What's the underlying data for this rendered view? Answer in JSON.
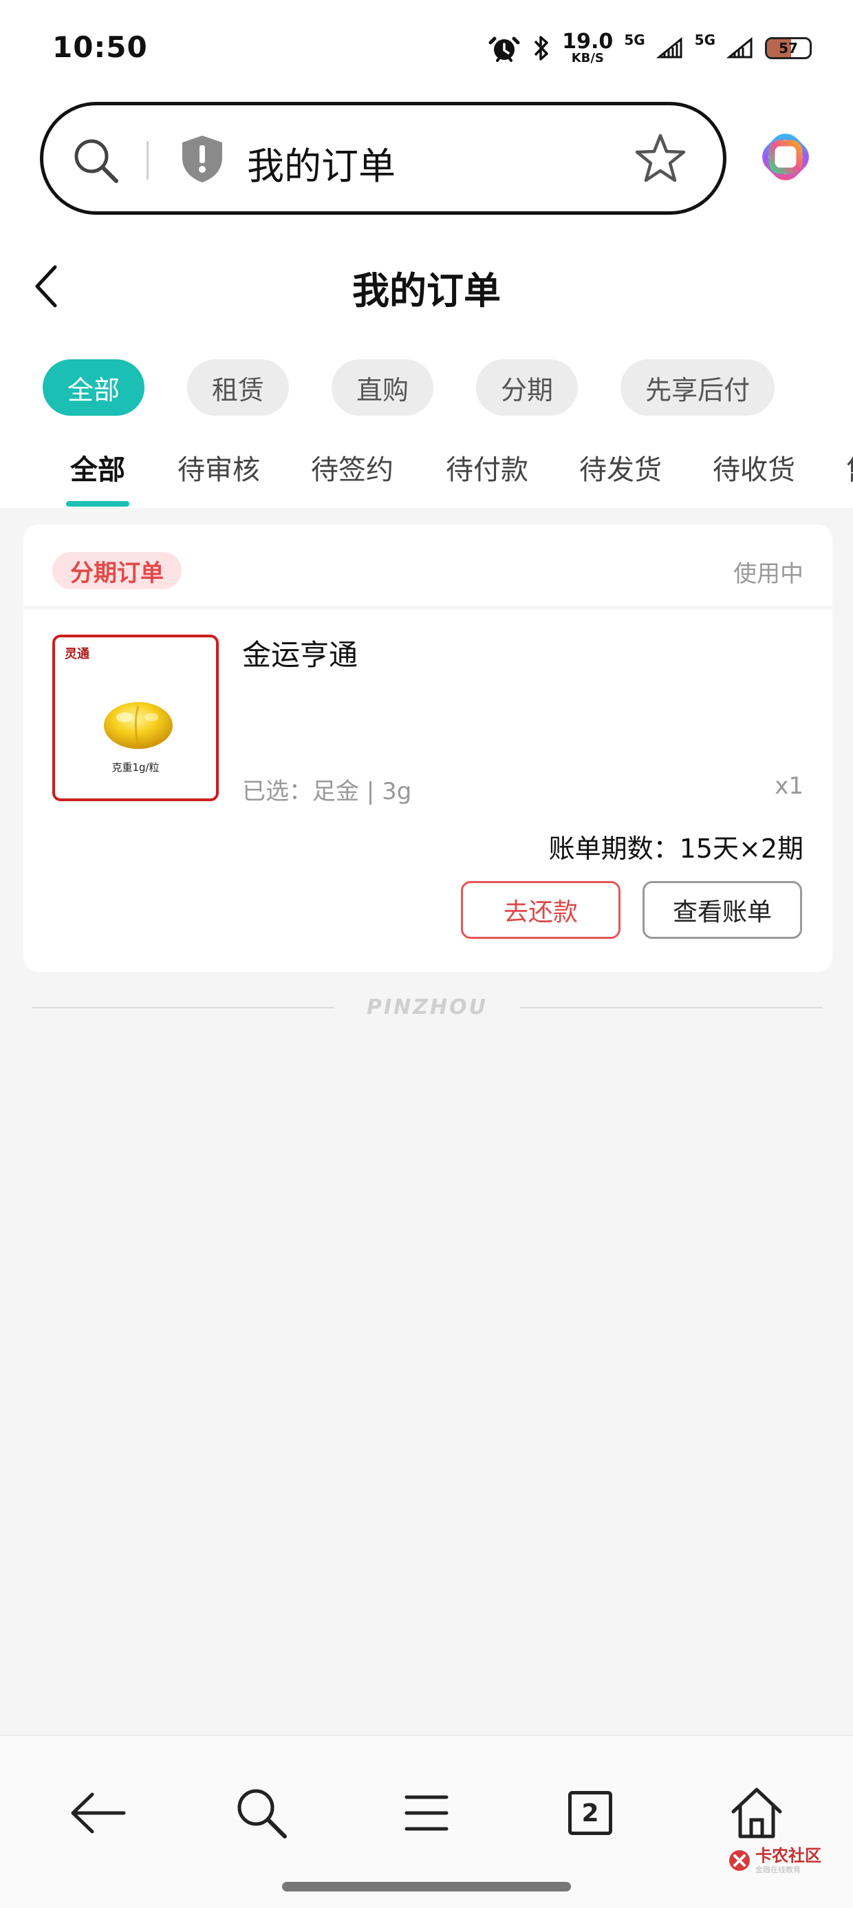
{
  "status_bar": {
    "time": "10:50",
    "speed_value": "19.0",
    "speed_unit": "KB/S",
    "network_1": "5G",
    "network_2": "5G",
    "battery": "57",
    "battery_level": 0.57,
    "icons": [
      "alarm-icon",
      "bluetooth-icon",
      "signal-icon",
      "signal-icon",
      "battery-icon"
    ]
  },
  "search_bar": {
    "text": "我的订单",
    "icons": [
      "search-icon",
      "shield-alert-icon",
      "star-icon",
      "app-logo-icon"
    ]
  },
  "header": {
    "title": "我的订单",
    "back_icon": "chevron-left-icon"
  },
  "categories": [
    {
      "label": "全部",
      "active": true
    },
    {
      "label": "租赁",
      "active": false
    },
    {
      "label": "直购",
      "active": false
    },
    {
      "label": "分期",
      "active": false
    },
    {
      "label": "先享后付",
      "active": false
    }
  ],
  "status_tabs": [
    {
      "label": "全部",
      "active": true
    },
    {
      "label": "待审核",
      "active": false
    },
    {
      "label": "待签约",
      "active": false
    },
    {
      "label": "待付款",
      "active": false
    },
    {
      "label": "待发货",
      "active": false
    },
    {
      "label": "待收货",
      "active": false
    },
    {
      "label": "售",
      "active": false
    }
  ],
  "order": {
    "badge": "分期订单",
    "status": "使用中",
    "thumbnail_brand": "灵通",
    "thumbnail_spec": "克重1g/粒",
    "product_name": "金运亨通",
    "selected": "已选：足金 | 3g",
    "quantity": "x1",
    "bill_period": "账单期数：15天×2期",
    "repay_button": "去还款",
    "view_bill_button": "查看账单"
  },
  "footer_mark": "PINZHOU",
  "bottom_nav": {
    "tab_count": "2",
    "icons": [
      "back-arrow-icon",
      "search-icon",
      "menu-icon",
      "tabs-icon",
      "home-icon"
    ]
  },
  "watermark": {
    "main": "卡农社区",
    "sub": "金融在线教育"
  },
  "colors": {
    "accent": "#1bbfb3",
    "danger": "#e04a4a",
    "background": "#f5f5f5"
  }
}
